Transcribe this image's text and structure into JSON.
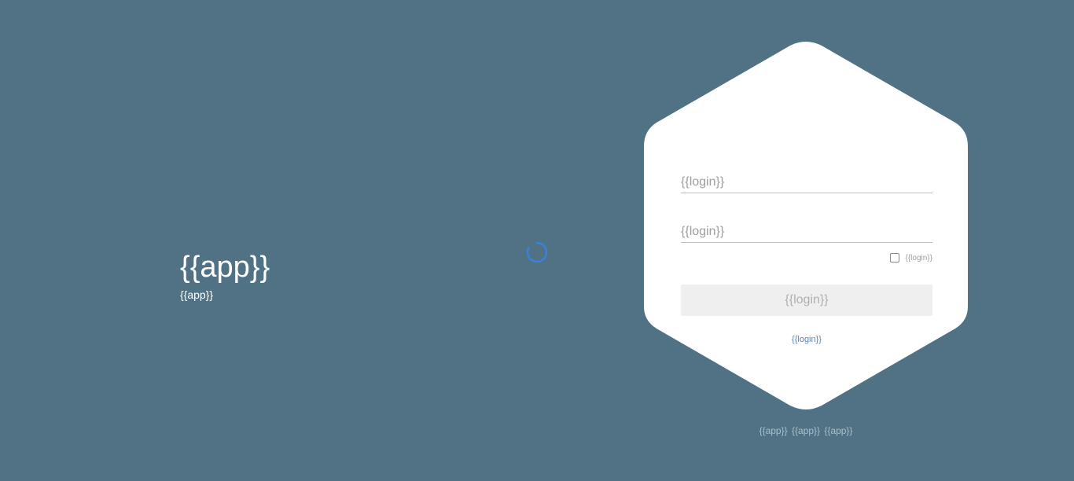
{
  "brand": {
    "title": "{{app}}",
    "subtitle": "{{app}}"
  },
  "login": {
    "username_placeholder": "{{login}}",
    "password_placeholder": "{{login}}",
    "remember_label": "{{login}}",
    "submit_label": "{{login}}",
    "forgot_link": "{{login}}"
  },
  "footer": {
    "links": [
      "{{app}}",
      "{{app}}",
      "{{app}}"
    ]
  },
  "colors": {
    "background": "#507284",
    "card": "#ffffff",
    "spinner": "#3b82d6",
    "link": "#5b84b8"
  },
  "icons": {
    "spinner": "loading-spinner-icon",
    "checkbox": "checkbox-unchecked-icon"
  }
}
